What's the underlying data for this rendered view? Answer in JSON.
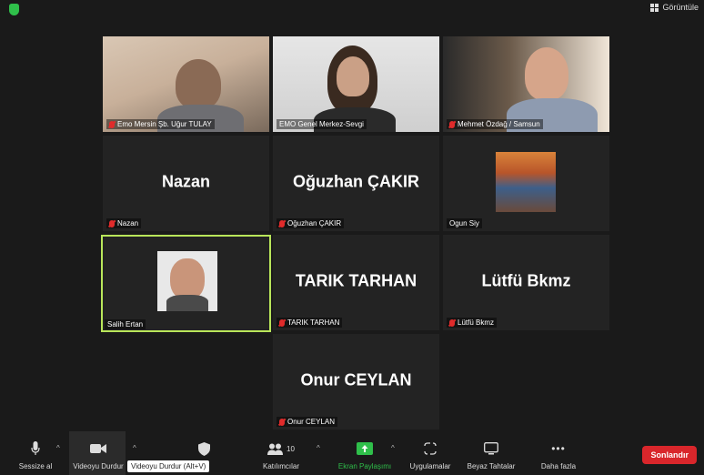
{
  "header": {
    "view_label": "Görüntüle"
  },
  "participants": [
    {
      "name": "Emo Mersin Şb. Uğur TULAY",
      "muted": true,
      "type": "video"
    },
    {
      "name": "EMO Genel Merkez-Sevgi",
      "muted": false,
      "type": "video"
    },
    {
      "name": "Mehmet Özdağ / Samsun",
      "muted": true,
      "type": "video"
    },
    {
      "display": "Nazan",
      "name": "Nazan",
      "muted": true,
      "type": "text"
    },
    {
      "display": "Oğuzhan ÇAKIR",
      "name": "Oğuzhan ÇAKIR",
      "muted": true,
      "type": "text"
    },
    {
      "name": "Ogun Siy",
      "muted": false,
      "type": "photo"
    },
    {
      "name": "Salih Ertan",
      "muted": false,
      "type": "photo",
      "active_speaker": true
    },
    {
      "display": "TARIK TARHAN",
      "name": "TARIK TARHAN",
      "muted": true,
      "type": "text"
    },
    {
      "display": "Lütfü Bkmz",
      "name": "Lütfü Bkmz",
      "muted": true,
      "type": "text"
    },
    {
      "display": "Onur CEYLAN",
      "name": "Onur CEYLAN",
      "muted": true,
      "type": "text"
    }
  ],
  "toolbar": {
    "mute_label": "Sessize al",
    "video_label": "Videoyu Durdur",
    "tooltip": "Videoyu Durdur (Alt+V)",
    "participants_label": "Katılımcılar",
    "participants_count": "10",
    "share_label": "Ekran Paylaşımı",
    "apps_label": "Uygulamalar",
    "whiteboard_label": "Beyaz Tahtalar",
    "more_label": "Daha fazla",
    "end_label": "Sonlandır"
  },
  "colors": {
    "share_green": "#2fbf4a",
    "end_red": "#d9262b",
    "speaker_outline": "#b9e65a",
    "muted_red": "#e02b2b"
  }
}
